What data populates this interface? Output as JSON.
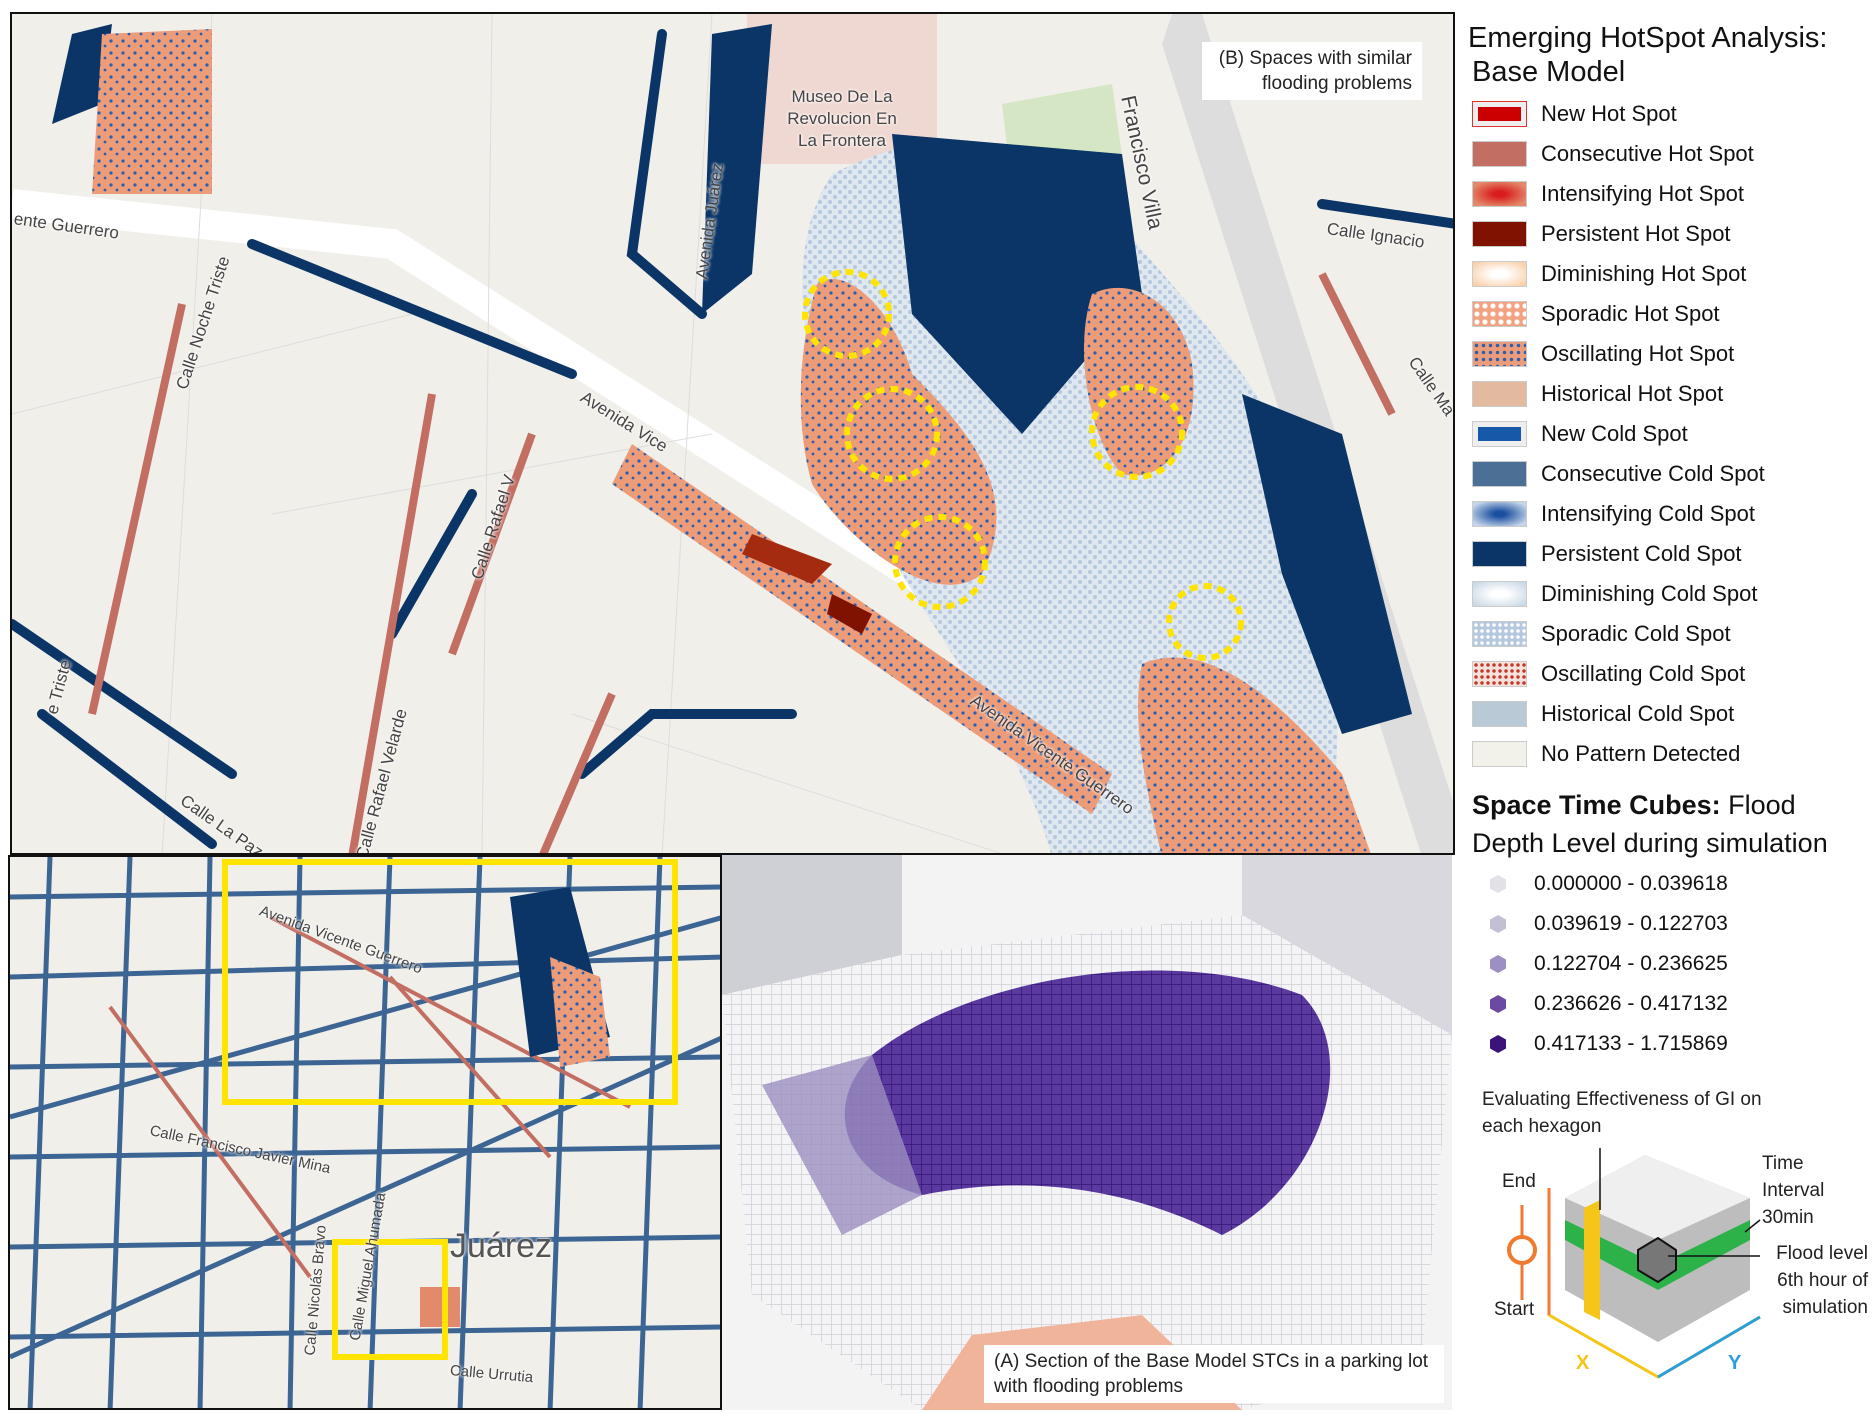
{
  "top_map": {
    "museum_label": "Museo De La Revolucion En La Frontera",
    "callout_b": "(B) Spaces with similar flooding problems",
    "street_labels": [
      "Francisco Villa",
      "Calle Ignacio",
      "Calle Ma",
      "ente Guerrero",
      "Calle Noche Triste",
      "Avenida Juárez",
      "Avenida Vice",
      "Calle Rafael V",
      "Avenida Vicente Guerrero",
      "Calle Rafael Velarde",
      "Calle La Paz",
      "e Triste"
    ]
  },
  "bottom_left_map": {
    "street_labels": [
      "Avenida Vicente Guerrero",
      "Calle Francisco Javier Mina",
      "Calle Miguel Ahumada",
      "Calle Urrutia",
      "Calle Nicolás Bravo",
      "Juárez"
    ]
  },
  "stc_view": {
    "callout_a": "(A) Section of the Base Model STCs in a parking lot with flooding problems"
  },
  "legend": {
    "title_line1": "Emerging HotSpot Analysis:",
    "title_line2": "Base Model",
    "items": [
      {
        "label": "New Hot Spot",
        "color": "#cc0000"
      },
      {
        "label": "Consecutive Hot Spot",
        "color": "#c26e63"
      },
      {
        "label": "Intensifying Hot Spot",
        "color": "#e28a6b"
      },
      {
        "label": "Persistent Hot Spot",
        "color": "#7f1200"
      },
      {
        "label": "Diminishing Hot Spot",
        "color": "#f9cfa9"
      },
      {
        "label": "Sporadic Hot Spot",
        "color": "#f0a283"
      },
      {
        "label": "Oscillating Hot Spot",
        "color": "#ec9c78"
      },
      {
        "label": "Historical Hot Spot",
        "color": "#e3b9a0"
      },
      {
        "label": "New Cold Spot",
        "color": "#1858a8"
      },
      {
        "label": "Consecutive Cold Spot",
        "color": "#4c6f96"
      },
      {
        "label": "Intensifying Cold Spot",
        "color": "#5d87bf"
      },
      {
        "label": "Persistent Cold Spot",
        "color": "#0b3566"
      },
      {
        "label": "Diminishing Cold Spot",
        "color": "#c9d9e6"
      },
      {
        "label": "Sporadic Cold Spot",
        "color": "#b6c8df"
      },
      {
        "label": "Oscillating Cold Spot",
        "color": "#f0c9bf"
      },
      {
        "label": "Historical Cold Spot",
        "color": "#b9c9d6"
      },
      {
        "label": "No Pattern Detected",
        "color": "#f2f1ea"
      }
    ],
    "stc_title_bold": "Space Time Cubes:",
    "stc_title_rest": " Flood",
    "stc_title_line2": "Depth Level during simulation",
    "stc_items": [
      {
        "label": "0.000000 - 0.039618",
        "color": "#e2e2e6"
      },
      {
        "label": "0.039619 - 0.122703",
        "color": "#c3c0d4"
      },
      {
        "label": "0.122704 - 0.236625",
        "color": "#9c8fc1"
      },
      {
        "label": "0.236626 - 0.417132",
        "color": "#6a4aa3"
      },
      {
        "label": "0.417133 - 1.715869",
        "color": "#3b1479"
      }
    ]
  },
  "diagram": {
    "title": "Evaluating Effectiveness of GI on each hexagon",
    "end": "End",
    "start": "Start",
    "time_interval": "Time Interval 30min",
    "flood_level": "Flood level 6th hour of simulation",
    "x_axis": "X",
    "y_axis": "Y"
  }
}
